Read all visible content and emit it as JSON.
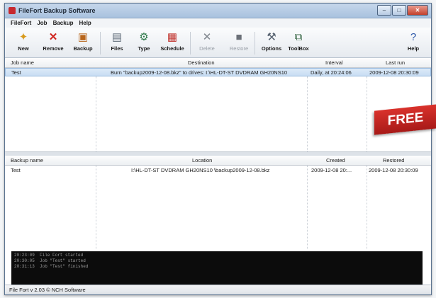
{
  "window": {
    "title": "FileFort Backup Software",
    "minimize": "–",
    "maximize": "□",
    "close": "✕"
  },
  "menu": [
    "FileFort",
    "Job",
    "Backup",
    "Help"
  ],
  "toolbar": {
    "new": "New",
    "remove": "Remove",
    "backup": "Backup",
    "files": "Files",
    "type": "Type",
    "schedule": "Schedule",
    "delete": "Delete",
    "restore": "Restore",
    "options": "Options",
    "toolbox": "ToolBox",
    "help": "Help"
  },
  "jobs": {
    "headers": [
      "Job name",
      "Destination",
      "Interval",
      "Last run"
    ],
    "rows": [
      {
        "name": "Test",
        "destination": "Burn \"backup2009-12-08.bkz\" to drives: I:\\HL-DT-ST DVDRAM GH20NS10",
        "interval": "Daily, at 20:24:06",
        "last_run": "2009-12-08 20:30:09"
      }
    ]
  },
  "backups": {
    "headers": [
      "Backup name",
      "Location",
      "Created",
      "Restored"
    ],
    "rows": [
      {
        "name": "Test",
        "location": "I:\\HL-DT-ST DVDRAM GH20NS10 \\backup2009-12-08.bkz",
        "created": "2009-12-08 20:...",
        "restored": "2009-12-08 20:30:09"
      }
    ]
  },
  "log": [
    {
      "time": "20:23:09",
      "text": "File Fort started"
    },
    {
      "time": "20:30:05",
      "text": "Job \"Test\" started"
    },
    {
      "time": "20:31:13",
      "text": "Job \"Test\" finished"
    }
  ],
  "status": "File Fort v 2.03 © NCH Software",
  "badge": "FREE",
  "colors": {
    "accent": "#c8ddf3",
    "badge": "#c7282e",
    "log_bg": "#0c0c0c"
  }
}
